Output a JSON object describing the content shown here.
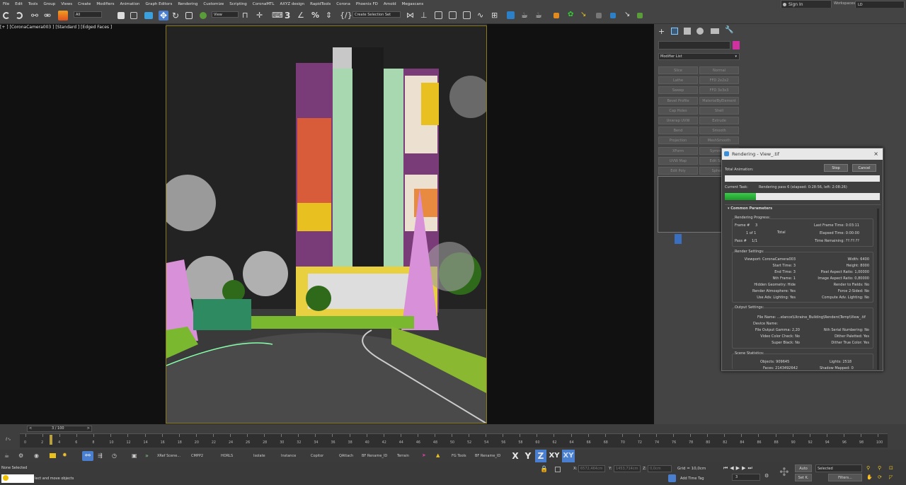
{
  "menu": [
    "File",
    "Edit",
    "Tools",
    "Group",
    "Views",
    "Create",
    "Modifiers",
    "Animation",
    "Graph Editors",
    "Rendering",
    "Customize",
    "Scripting",
    "CoronaMTL",
    "AXYZ design",
    "RapidTools",
    "Corona",
    "Phoenix FD",
    "Arnold",
    "Megascans"
  ],
  "signin": "Sign In",
  "workspaces_label": "Workspaces:",
  "workspace_value": "LD",
  "toolbar": {
    "filter_value": "All",
    "view_value": "View",
    "selection_set": "Create Selection Set"
  },
  "viewport_label": "[+ ] [CoronaCamera003 ] [Standard ] [Edged Faces ]",
  "cmdpanel": {
    "modifier_list": "Modifier List",
    "modifiers": [
      "Slice",
      "Normal",
      "Lathe",
      "FFD 2x2x2",
      "Sweep",
      "FFD 3x3x3",
      "Bevel Profile",
      "MaterialByElement",
      "Cap Holes",
      "Shell",
      "Unwrap UVW",
      "Extrude",
      "Bend",
      "Smooth",
      "Projection",
      "MeshSmooth",
      "XForm",
      "Symmetry",
      "UVW Map",
      "Edit Spline",
      "Edit Poly",
      "Spherify"
    ]
  },
  "render": {
    "title": "Rendering - View_.tif",
    "total_animation": "Total Animation:",
    "stop": "Stop",
    "cancel": "Cancel",
    "current_task_label": "Current Task:",
    "current_task": "Rendering pass 6 (elapsed: 0:28:56, left: 2:08:26)",
    "current_progress": 0.2,
    "common_params": "Common Parameters",
    "rendering_progress": "Rendering Progress:",
    "frame_label": "Frame #",
    "frame_value": "3",
    "one_of_one": "1  of  1",
    "total": "Total",
    "pass_label": "Pass #",
    "pass_value": "1/1",
    "last_frame_time": "Last Frame Time:  0:03:11",
    "elapsed_time": "Elapsed Time:  0:00:00",
    "time_remaining": "Time Remaining:  ??:??:??",
    "render_settings": "Render Settings:",
    "rs_left": [
      "Viewport:  CoronaCamera003",
      "Start Time:  3",
      "End Time:  3",
      "Nth Frame:  1",
      "Hidden Geometry:  Hide",
      "Render Atmosphere:  Yes",
      "Use Adv. Lighting:  Yes"
    ],
    "rs_right": [
      "Width:  6400",
      "Height:  8000",
      "Pixel Aspect Ratio:  1,00000",
      "Image Aspect Ratio:  0,80000",
      "Render to Fields:  No",
      "Force 2-Sided:  No",
      "Compute Adv. Lighting:  No"
    ],
    "output_settings": "Output Settings:",
    "file_name": "File Name:  ...elance\\Ukraine_Building\\Renders\\Temp\\View_.tif",
    "device_name": "Device Name:",
    "os_left": [
      "File Output Gamma:  2,20",
      "Video Color Check:  No",
      "Super Black:  No"
    ],
    "os_right": [
      "Nth Serial Numbering:  No",
      "Dither Paletted:  Yes",
      "Dither True Color:  Yes"
    ],
    "scene_stats": "Scene Statistics:",
    "objects": "Objects:  909645",
    "lights": "Lights:  2518",
    "faces": "Faces:  2143492642",
    "shadow_mapped": "Shadow Mapped:  0"
  },
  "timeline": {
    "frame_display": "3 / 100",
    "ticks": [
      "0",
      "2",
      "4",
      "6",
      "8",
      "10",
      "12",
      "14",
      "16",
      "18",
      "20",
      "22",
      "24",
      "26",
      "28",
      "30",
      "32",
      "34",
      "36",
      "38",
      "40",
      "42",
      "44",
      "46",
      "48",
      "50",
      "52",
      "54",
      "56",
      "58",
      "60",
      "62",
      "64",
      "66",
      "68",
      "70",
      "72",
      "74",
      "76",
      "78",
      "80",
      "82",
      "84",
      "86",
      "88",
      "90",
      "92",
      "94",
      "96",
      "98",
      "100"
    ],
    "current_frame": 3
  },
  "toolbar2": [
    "XRef Scene...",
    "CMPP2",
    "HORLS",
    "Isolate",
    "Instance",
    "Copitor",
    "QAttach",
    "BF Rename_ID",
    "Terrain",
    "FG Tools",
    "BF Rename_ID"
  ],
  "axes": [
    "X",
    "Y",
    "Z",
    "XY",
    "XY"
  ],
  "status": {
    "none_selected": "None Selected",
    "hint": "lect and move objects",
    "x_label": "X:",
    "x_value": "6572,464cm",
    "y_label": "Y:",
    "y_value": "1453,714cm",
    "z_label": "Z:",
    "z_value": "0,0cm",
    "grid": "Grid = 10,0cm",
    "add_time_tag": "Add Time Tag",
    "auto": "Auto",
    "selected": "Selected",
    "set_k": "Set K.",
    "filters": "Filters...",
    "frame_field": "3"
  }
}
